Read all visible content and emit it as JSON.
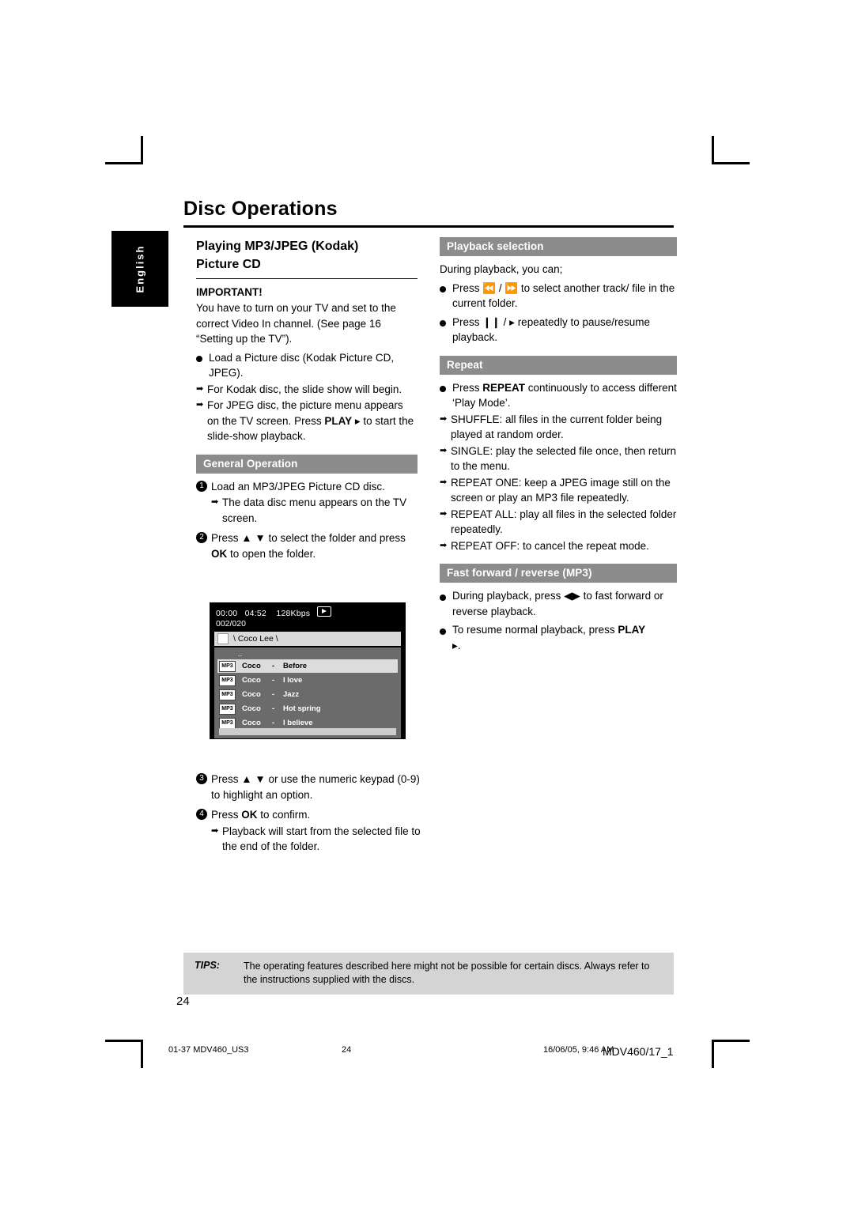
{
  "page": {
    "title": "Disc Operations",
    "lang_tab": "English",
    "page_number": "24"
  },
  "left": {
    "heading_line1": "Playing MP3/JPEG (Kodak)",
    "heading_line2": "Picture CD",
    "important_label": "IMPORTANT!",
    "important_text": "You have to turn on your TV and set to the correct Video In channel.  (See page 16 “Setting up the TV”).",
    "bullet1": "Load a Picture disc (Kodak Picture CD, JPEG).",
    "arrow1": "For Kodak disc, the slide show will begin.",
    "arrow2_a": "For JPEG disc, the picture menu appears on the TV screen. Press ",
    "arrow2_play": "PLAY",
    "arrow2_b": " to start the slide-show playback.",
    "general_op_bar": "General Operation",
    "step1": "Load an MP3/JPEG Picture CD disc.",
    "step1_arrow": "The data disc menu appears on the TV screen.",
    "step2_a": "Press ",
    "step2_b": " to select the folder and press ",
    "step2_ok": "OK",
    "step2_c": " to open the folder.",
    "step3_a": "Press ",
    "step3_b": " or use the numeric keypad (0-9) to highlight an option.",
    "step4_a": "Press ",
    "step4_ok": "OK",
    "step4_b": " to confirm.",
    "step4_arrow": "Playback will start from the selected file to the end of the folder."
  },
  "screen": {
    "time": "00:00",
    "total": "04:52",
    "bitrate": "128Kbps",
    "counter": "002/020",
    "path": "\\ Coco Lee \\",
    "dots": "..",
    "files": [
      {
        "tag": "MP3",
        "artist": "Coco",
        "dash": "-",
        "title": "Before",
        "selected": true
      },
      {
        "tag": "MP3",
        "artist": "Coco",
        "dash": "-",
        "title": "I love",
        "selected": false
      },
      {
        "tag": "MP3",
        "artist": "Coco",
        "dash": "-",
        "title": "Jazz",
        "selected": false
      },
      {
        "tag": "MP3",
        "artist": "Coco",
        "dash": "-",
        "title": "Hot spring",
        "selected": false
      },
      {
        "tag": "MP3",
        "artist": "Coco",
        "dash": "-",
        "title": "I believe",
        "selected": false
      }
    ]
  },
  "right": {
    "playback_bar": "Playback selection",
    "playback_intro": "During playback, you can;",
    "pb_b1_a": "Press ",
    "pb_b1_b": " to select another track/ file in the current folder.",
    "pb_b2_a": "Press ",
    "pb_b2_b": " repeatedly to pause/resume playback.",
    "repeat_bar": "Repeat",
    "rep_b1_a": "Press ",
    "rep_b1_key": "REPEAT",
    "rep_b1_b": " continuously to access different ‘Play Mode’.",
    "rep_a1": "SHUFFLE: all files in the current folder being played at random order.",
    "rep_a2": "SINGLE: play the selected file once, then return to the menu.",
    "rep_a3": "REPEAT ONE: keep a JPEG image still on the screen or play an MP3 file repeatedly.",
    "rep_a4": "REPEAT ALL: play all files in the selected folder repeatedly.",
    "rep_a5": "REPEAT OFF: to cancel the repeat mode.",
    "ff_bar": "Fast forward / reverse (MP3)",
    "ff_b1_a": "During playback, press ",
    "ff_b1_b": " to fast forward or reverse playback.",
    "ff_b2_a": "To resume normal playback, press ",
    "ff_b2_key": "PLAY",
    "ff_b2_b": "."
  },
  "tips": {
    "label": "TIPS:",
    "text": "The operating features described here might not be possible for certain discs.  Always refer to the instructions supplied with the discs."
  },
  "footer": {
    "doc": "01-37 MDV460_US3",
    "page": "24",
    "date": "16/06/05, 9:46 AM",
    "model": "MDV460/17_1"
  }
}
